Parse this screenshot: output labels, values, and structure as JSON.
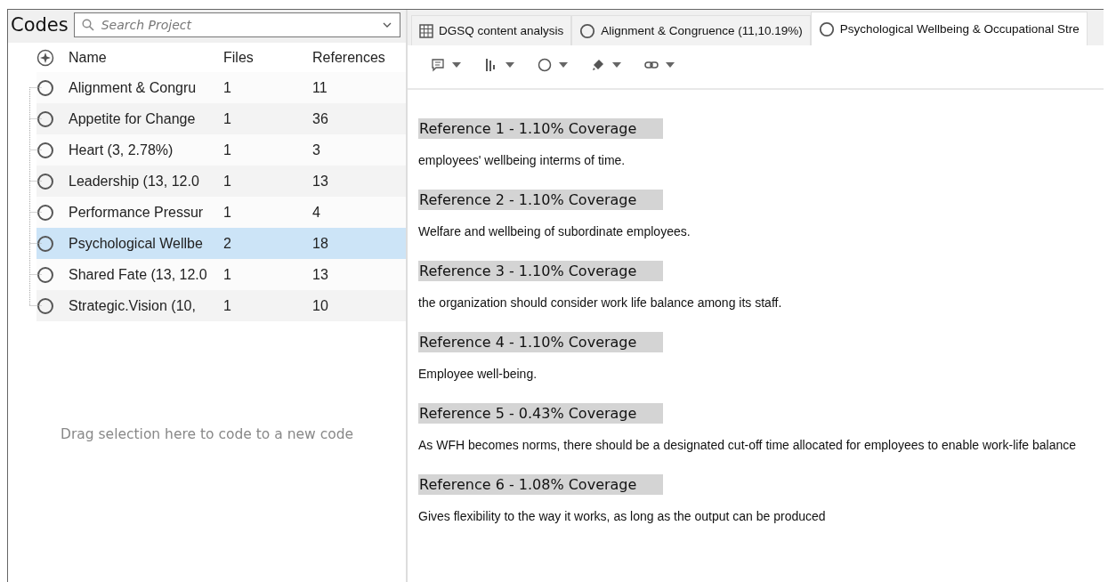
{
  "codes_panel": {
    "title": "Codes",
    "search": {
      "placeholder": "Search Project"
    },
    "columns": [
      "Name",
      "Files",
      "References"
    ],
    "rows": [
      {
        "name": "Alignment & Congru",
        "files": "1",
        "references": "11",
        "selected": false
      },
      {
        "name": "Appetite for Change",
        "files": "1",
        "references": "36",
        "selected": false
      },
      {
        "name": "Heart (3, 2.78%)",
        "files": "1",
        "references": "3",
        "selected": false
      },
      {
        "name": "Leadership (13, 12.0",
        "files": "1",
        "references": "13",
        "selected": false
      },
      {
        "name": "Performance Pressur",
        "files": "1",
        "references": "4",
        "selected": false
      },
      {
        "name": "Psychological Wellbe",
        "files": "2",
        "references": "18",
        "selected": true
      },
      {
        "name": "Shared Fate (13, 12.0",
        "files": "1",
        "references": "13",
        "selected": false
      },
      {
        "name": "Strategic.Vision (10,",
        "files": "1",
        "references": "10",
        "selected": false
      }
    ],
    "drop_hint": "Drag selection here to code to a new code"
  },
  "tabs": [
    {
      "label": "DGSQ content analysis",
      "kind": "table",
      "selected": false
    },
    {
      "label": "Alignment & Congruence (11,10.19%)",
      "kind": "code",
      "selected": false
    },
    {
      "label": "Psychological Wellbeing & Occupational Stre",
      "kind": "code",
      "selected": true
    }
  ],
  "references": [
    {
      "heading": "Reference 1 - 1.10% Coverage",
      "text": "employees' wellbeing interms of time."
    },
    {
      "heading": "Reference 2 - 1.10% Coverage",
      "text": "Welfare and wellbeing of subordinate employees."
    },
    {
      "heading": "Reference 3 - 1.10% Coverage",
      "text": "the organization should consider work life balance among its staff."
    },
    {
      "heading": "Reference 4 - 1.10% Coverage",
      "text": "Employee well-being."
    },
    {
      "heading": "Reference 5 - 0.43% Coverage",
      "text": "As WFH becomes norms, there should be a designated cut-off time allocated for employees to enable work-life balance"
    },
    {
      "heading": "Reference 6 - 1.08% Coverage",
      "text": "Gives flexibility to the way it works, as long as the output can be produced"
    }
  ]
}
